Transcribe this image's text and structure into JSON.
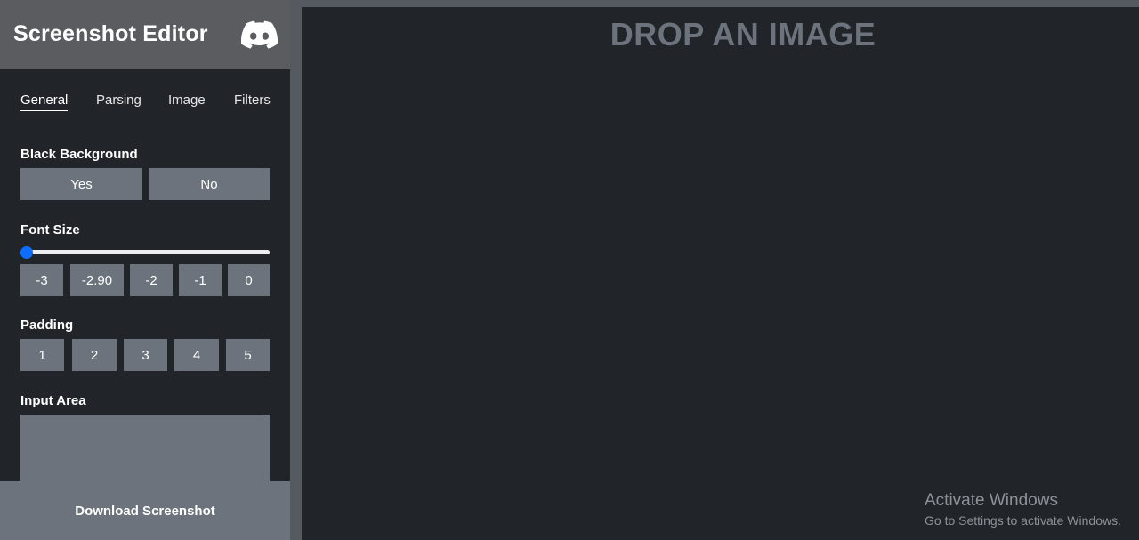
{
  "app": {
    "title": "Screenshot Editor",
    "brand_icon": "discord-icon"
  },
  "tabs": [
    {
      "label": "General",
      "active": true
    },
    {
      "label": "Parsing",
      "active": false
    },
    {
      "label": "Image",
      "active": false
    },
    {
      "label": "Filters",
      "active": false
    }
  ],
  "black_background": {
    "label": "Black Background",
    "options": [
      "Yes",
      "No"
    ]
  },
  "font_size": {
    "label": "Font Size",
    "slider_value": 0.0,
    "presets": [
      "-3",
      "-2.90",
      "-2",
      "-1",
      "0"
    ]
  },
  "padding": {
    "label": "Padding",
    "options": [
      "1",
      "2",
      "3",
      "4",
      "5"
    ]
  },
  "input_area": {
    "label": "Input Area",
    "value": ""
  },
  "download": {
    "label": "Download Screenshot"
  },
  "main": {
    "drop_text": "DROP AN IMAGE"
  },
  "watermark": {
    "title": "Activate Windows",
    "subtitle": "Go to Settings to activate Windows."
  },
  "colors": {
    "sidebar_bg": "#212429",
    "header_bg": "#5a5c5f",
    "button_bg": "#6c737c",
    "accent": "#0d6efd",
    "page_bg": "#555a60"
  }
}
